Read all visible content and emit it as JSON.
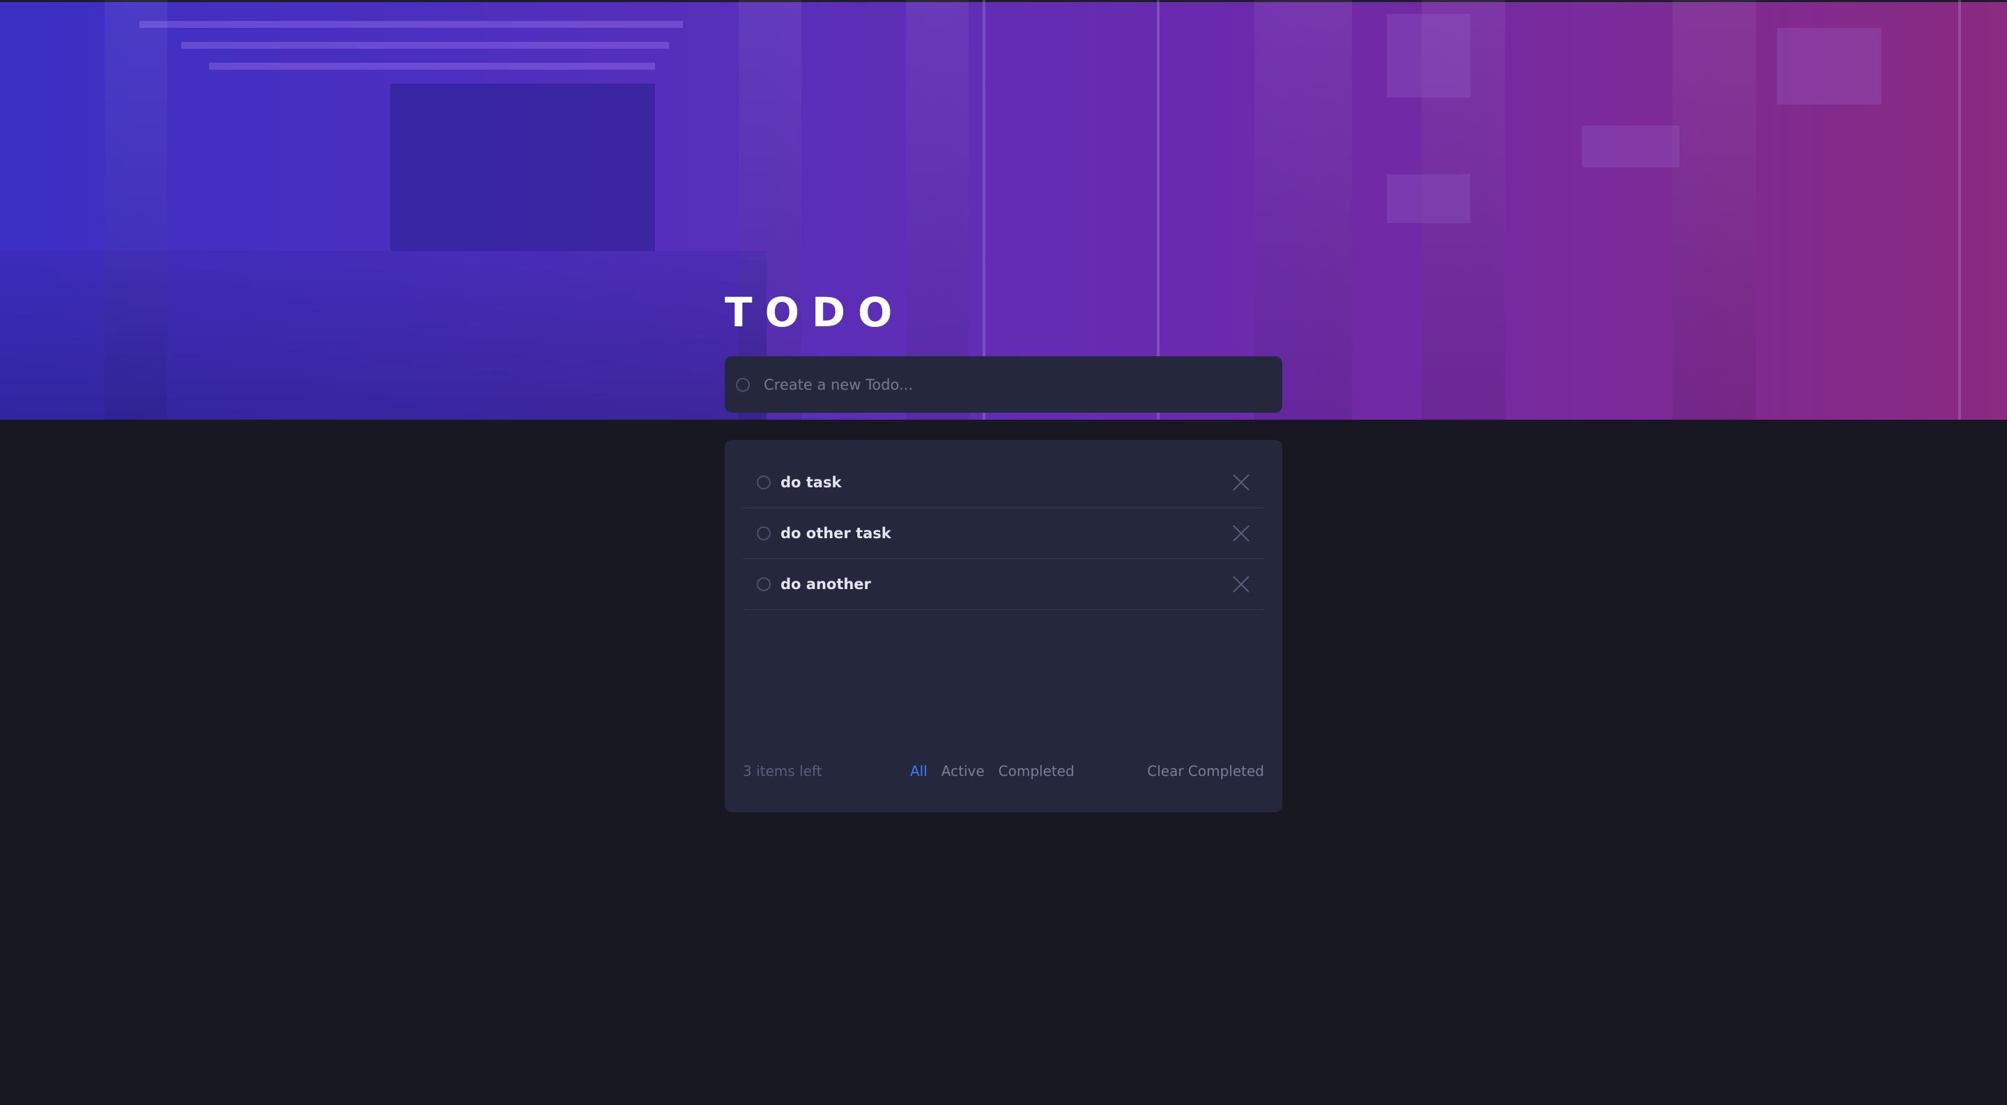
{
  "app": {
    "title": "TODO"
  },
  "new_todo": {
    "placeholder": "Create a new Todo..."
  },
  "todos": [
    {
      "text": "do task",
      "completed": false
    },
    {
      "text": "do other task",
      "completed": false
    },
    {
      "text": "do another",
      "completed": false
    }
  ],
  "footer": {
    "items_left": "3 items left",
    "filters": [
      {
        "label": "All",
        "active": true
      },
      {
        "label": "Active",
        "active": false
      },
      {
        "label": "Completed",
        "active": false
      }
    ],
    "clear_label": "Clear Completed"
  },
  "icons": {
    "check": "circle-check-icon",
    "delete": "cross-icon"
  },
  "colors": {
    "background": "#171821",
    "card": "#25273c",
    "accent": "#3a7cfd",
    "hero_start": "#3b2fc4",
    "hero_end": "#8a2a80"
  }
}
